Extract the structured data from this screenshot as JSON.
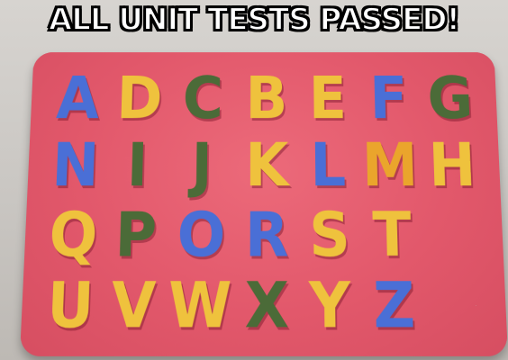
{
  "caption": "ALL UNIT TESTS PASSED!",
  "letters": [
    {
      "char": "A",
      "color": "#4a6fd6"
    },
    {
      "char": "D",
      "color": "#efc23d"
    },
    {
      "char": "C",
      "color": "#4b6b38"
    },
    {
      "char": "B",
      "color": "#efc23d"
    },
    {
      "char": "E",
      "color": "#efc23d"
    },
    {
      "char": "F",
      "color": "#4a6fd6"
    },
    {
      "char": "G",
      "color": "#4b6b38"
    },
    {
      "char": "N",
      "color": "#4a6fd6"
    },
    {
      "char": "I",
      "color": "#4b6b38"
    },
    {
      "char": "J",
      "color": "#4b6b38"
    },
    {
      "char": "K",
      "color": "#efc23d"
    },
    {
      "char": "L",
      "color": "#4a6fd6"
    },
    {
      "char": "M",
      "color": "#eaa52c"
    },
    {
      "char": "H",
      "color": "#efc23d"
    },
    {
      "char": "Q",
      "color": "#efc23d"
    },
    {
      "char": "P",
      "color": "#4b6b38"
    },
    {
      "char": "O",
      "color": "#4a6fd6"
    },
    {
      "char": "R",
      "color": "#4a6fd6"
    },
    {
      "char": "S",
      "color": "#efc23d"
    },
    {
      "char": "T",
      "color": "#efc23d"
    },
    {
      "char": "",
      "color": ""
    },
    {
      "char": "U",
      "color": "#efc23d"
    },
    {
      "char": "V",
      "color": "#efc23d"
    },
    {
      "char": "W",
      "color": "#efc23d"
    },
    {
      "char": "X",
      "color": "#4b6b38"
    },
    {
      "char": "Y",
      "color": "#efc23d"
    },
    {
      "char": "Z",
      "color": "#4a6fd6"
    },
    {
      "char": "",
      "color": ""
    }
  ]
}
